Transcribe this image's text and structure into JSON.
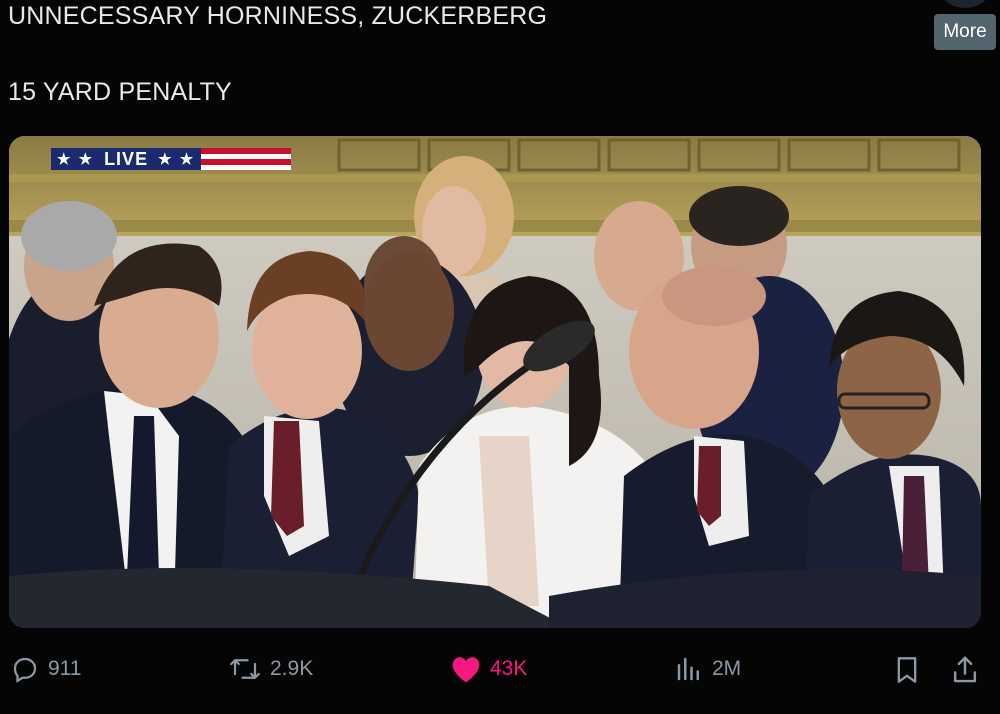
{
  "tweet": {
    "line1": "UNNECESSARY HORNINESS, ZUCKERBERG",
    "line2": "15 YARD PENALTY"
  },
  "more_button": {
    "label": "More"
  },
  "video": {
    "live_badge": {
      "stars_left": "★ ★",
      "label": "LIVE",
      "stars_right": "★ ★"
    }
  },
  "actions": {
    "reply": {
      "icon": "reply-icon",
      "count": "911"
    },
    "repost": {
      "icon": "repost-icon",
      "count": "2.9K"
    },
    "like": {
      "icon": "heart-icon",
      "count": "43K",
      "liked": true,
      "color": "#f91880"
    },
    "views": {
      "icon": "views-icon",
      "count": "2M"
    },
    "bookmark": {
      "icon": "bookmark-icon"
    },
    "share": {
      "icon": "share-icon"
    }
  },
  "colors": {
    "background": "#000000",
    "text": "#e7e9ea",
    "muted": "#8b98a5",
    "like": "#f91880",
    "more_button_bg": "#54646f"
  }
}
